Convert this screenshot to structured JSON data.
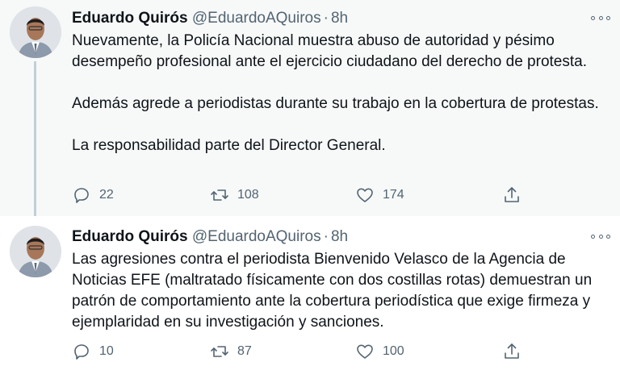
{
  "tweets": [
    {
      "author": {
        "name": "Eduardo Quirós",
        "handle": "@EduardoAQuiros",
        "time": "8h"
      },
      "text": [
        "Nuevamente, la Policía Nacional muestra abuso de autoridad y pésimo desempeño profesional ante el ejercicio ciudadano del derecho de protesta.",
        "Además agrede a periodistas durante su trabajo en la cobertura de protestas.",
        "La responsabilidad parte del Director General."
      ],
      "stats": {
        "replies": "22",
        "retweets": "108",
        "likes": "174"
      }
    },
    {
      "author": {
        "name": "Eduardo Quirós",
        "handle": "@EduardoAQuiros",
        "time": "8h"
      },
      "text": [
        "Las agresiones contra el periodista Bienvenido Velasco de la Agencia de Noticias EFE (maltratado físicamente con dos costillas rotas) demuestran un patrón de comportamiento ante la cobertura periodística que exige firmeza y ejemplaridad en su investigación y sanciones."
      ],
      "stats": {
        "replies": "10",
        "retweets": "87",
        "likes": "100"
      }
    }
  ],
  "separator": "·",
  "icons": {
    "reply": "reply-icon",
    "retweet": "retweet-icon",
    "like": "heart-icon",
    "share": "share-icon",
    "more": "more-horizontal-icon"
  },
  "colors": {
    "text": "#0f1419",
    "secondary": "#536471",
    "thread_line": "#c4cfd6",
    "highlight_bg": "#f7f9f9"
  }
}
